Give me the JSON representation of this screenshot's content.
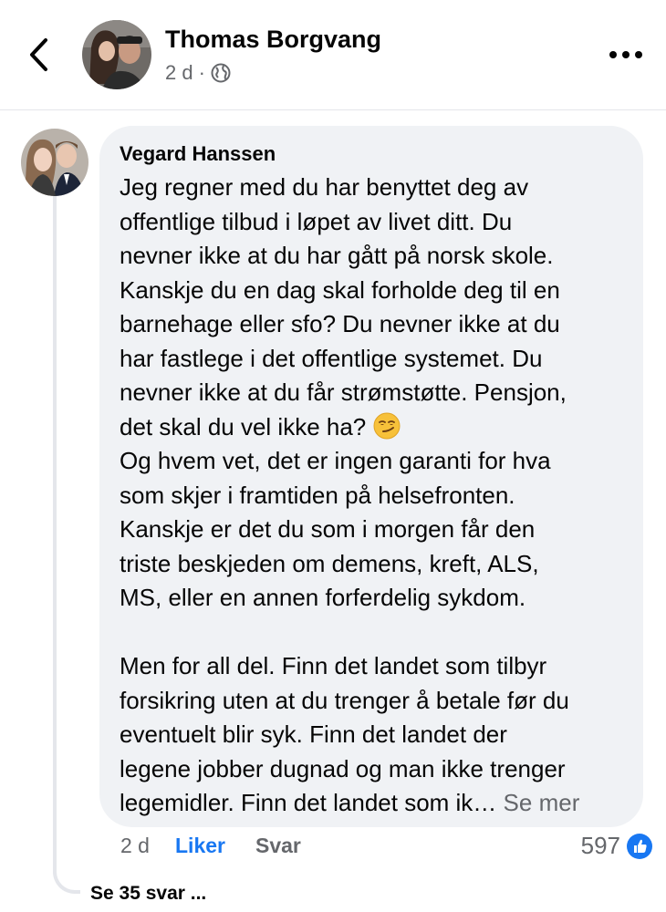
{
  "header": {
    "name": "Thomas Borgvang",
    "time": "2 d",
    "separator": "·",
    "audience_icon": "globe-icon",
    "back_icon": "chevron-left-icon",
    "more_icon": "more-horizontal-icon"
  },
  "comment": {
    "author": "Vegard Hanssen",
    "lines": [
      "Jeg regner med du har benyttet deg av",
      "offentlige tilbud i løpet av livet ditt. Du",
      "nevner ikke at du har gått på norsk skole.",
      "Kanskje du en dag skal forholde deg til en",
      "barnehage eller sfo? Du nevner ikke at du",
      "har fastlege i det offentlige systemet. Du",
      "nevner ikke at du får strømstøtte. Pensjon,",
      "det skal du vel ikke ha?",
      "Og hvem vet, det er ingen garanti for hva",
      "som skjer i framtiden på helsefronten.",
      "Kanskje er det du som i morgen får den",
      "triste beskjeden om demens, kreft, ALS,",
      "MS, eller en annen forferdelig sykdom.",
      "",
      "Men for all del. Finn det landet som tilbyr",
      "forsikring uten at du trenger å betale før du",
      "eventuelt blir syk. Finn det landet der",
      "legene jobber dugnad og man ikke trenger",
      "legemidler. Finn det landet som ik…"
    ],
    "emoji": "smirking-face-emoji",
    "see_more": "Se mer",
    "time": "2 d",
    "like_label": "Liker",
    "reply_label": "Svar",
    "reaction_count": "597",
    "reaction_icon": "like-thumb-icon"
  },
  "replies": {
    "label": "Se 35 svar ..."
  },
  "colors": {
    "accent": "#1877f2",
    "bubble": "#f0f2f5",
    "muted": "#65676b",
    "text": "#050505"
  }
}
